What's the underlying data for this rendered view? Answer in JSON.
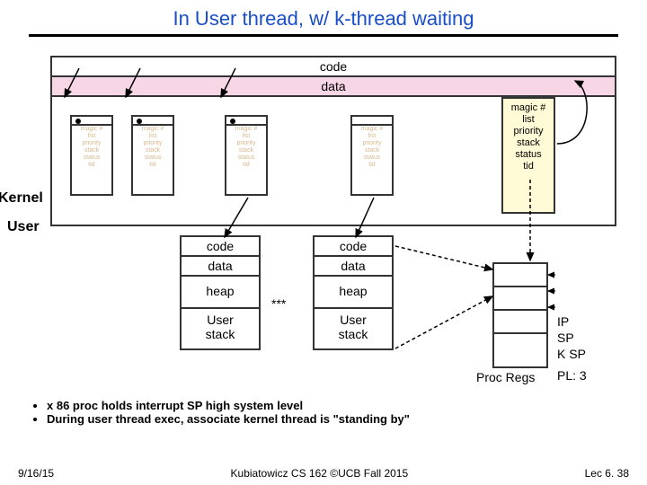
{
  "title": "In User thread, w/ k-thread waiting",
  "kernel_label": "Kernel",
  "user_label": "User",
  "kernel_box": {
    "code": "code",
    "data": "data"
  },
  "tcb_fields": [
    "magic #",
    "list",
    "priority",
    "stack",
    "status",
    "tid"
  ],
  "procA": {
    "code": "code",
    "data": "data",
    "heap": "heap",
    "stack": "User\nstack"
  },
  "procB": {
    "code": "code",
    "data": "data",
    "heap": "heap",
    "stack": "User\nstack"
  },
  "asterisks": "***",
  "procregs_label": "Proc Regs",
  "reg_labels": {
    "ip": "IP",
    "sp": "SP",
    "ksp": "K SP",
    "pl": "PL: 3"
  },
  "bullets": [
    "x 86 proc holds interrupt SP high system level",
    "During user thread exec, associate kernel thread is \"standing by\""
  ],
  "footer": {
    "date": "9/16/15",
    "course": "Kubiatowicz CS 162 ©UCB Fall 2015",
    "page": "Lec 6. 38"
  }
}
